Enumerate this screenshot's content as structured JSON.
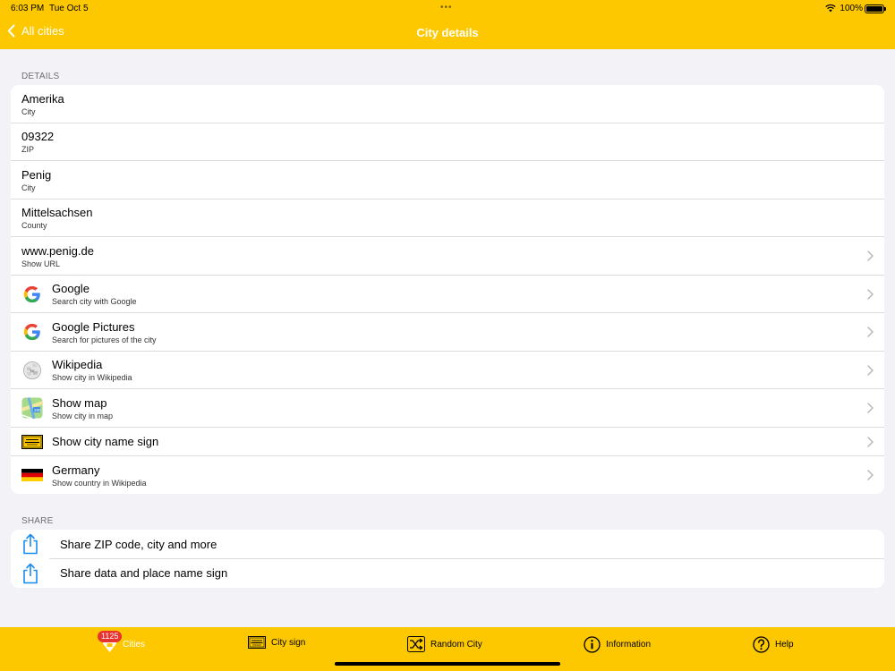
{
  "status_bar": {
    "time": "6:03 PM",
    "date": "Tue Oct 5",
    "battery": "100%"
  },
  "nav": {
    "back_label": "All cities",
    "title": "City details"
  },
  "details": {
    "header": "DETAILS",
    "rows": [
      {
        "title": "Amerika",
        "subtitle": "City"
      },
      {
        "title": "09322",
        "subtitle": "ZIP"
      },
      {
        "title": "Penig",
        "subtitle": "City"
      },
      {
        "title": "Mittelsachsen",
        "subtitle": "County"
      },
      {
        "title": "www.penig.de",
        "subtitle": "Show URL"
      },
      {
        "title": "Google",
        "subtitle": "Search city with Google",
        "icon": "google-icon"
      },
      {
        "title": "Google Pictures",
        "subtitle": "Search for pictures of the city",
        "icon": "google-icon"
      },
      {
        "title": "Wikipedia",
        "subtitle": "Show city in Wikipedia",
        "icon": "wikipedia-icon"
      },
      {
        "title": "Show map",
        "subtitle": "Show city in map",
        "icon": "map-icon"
      },
      {
        "title": "Show city name sign",
        "icon": "city-sign-icon"
      },
      {
        "title": "Germany",
        "subtitle": "Show country in Wikipedia",
        "icon": "germany-flag-icon"
      }
    ]
  },
  "share": {
    "header": "SHARE",
    "rows": [
      {
        "title": "Share ZIP code, city and more",
        "icon": "share-icon"
      },
      {
        "title": "Share data and place name sign",
        "icon": "share-icon"
      }
    ]
  },
  "tabbar": {
    "badge": "1125",
    "tabs": [
      {
        "label": "Cities",
        "icon": "cities-icon",
        "active": true
      },
      {
        "label": "City sign",
        "icon": "city-sign-icon"
      },
      {
        "label": "Random City",
        "icon": "shuffle-icon"
      },
      {
        "label": "Information",
        "icon": "info-icon"
      },
      {
        "label": "Help",
        "icon": "help-icon"
      }
    ]
  },
  "colors": {
    "accent": "#fdc800",
    "background": "#f2f2f7",
    "share_blue": "#1a8cf0",
    "badge_red": "#e8322e"
  }
}
